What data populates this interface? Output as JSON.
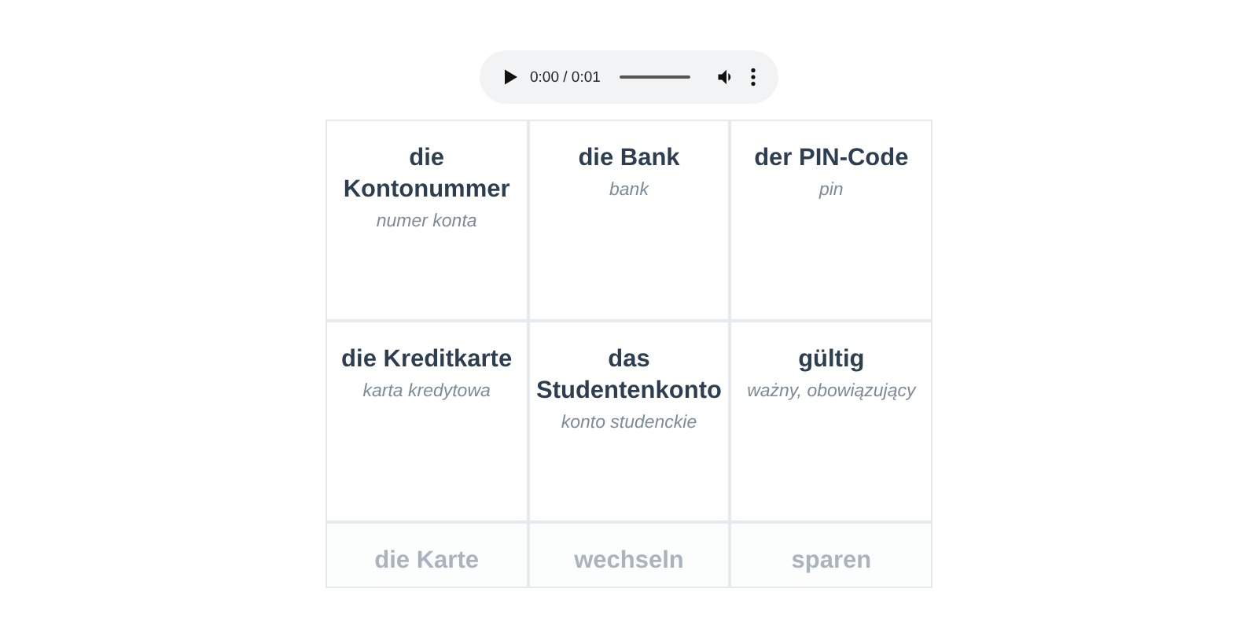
{
  "audio_player": {
    "time": "0:00 / 0:01"
  },
  "cards": [
    {
      "word": "die Kontonummer",
      "translation": "numer konta",
      "faded": false
    },
    {
      "word": "die Bank",
      "translation": "bank",
      "faded": false
    },
    {
      "word": "der PIN-Code",
      "translation": "pin",
      "faded": false
    },
    {
      "word": "die Kreditkarte",
      "translation": "karta kredytowa",
      "faded": false
    },
    {
      "word": "das Studentenkonto",
      "translation": "konto studenckie",
      "faded": false
    },
    {
      "word": "gültig",
      "translation": "ważny, obowiązujący",
      "faded": false
    },
    {
      "word": "die Karte",
      "faded": true
    },
    {
      "word": "wechseln",
      "faded": true
    },
    {
      "word": "sparen",
      "faded": true
    }
  ]
}
